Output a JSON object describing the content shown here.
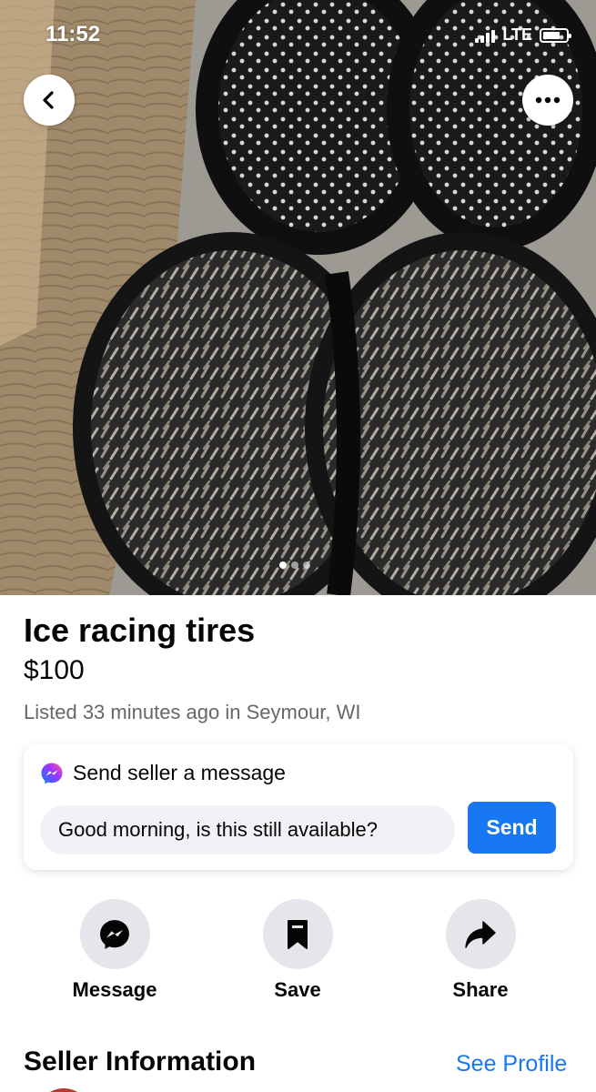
{
  "status_bar": {
    "time": "11:52",
    "network": "LTE"
  },
  "photo": {
    "description_icon": "listing-photo",
    "carousel": {
      "count": 3,
      "active_index": 0
    }
  },
  "nav": {
    "back_icon": "chevron-left-icon",
    "more_icon": "more-horizontal-icon"
  },
  "listing": {
    "title": "Ice racing tires",
    "price": "$100",
    "listed": "Listed 33 minutes ago in Seymour, WI"
  },
  "message_card": {
    "heading": "Send seller a message",
    "input_value": "Good morning, is this still available?",
    "send_label": "Send",
    "icon": "messenger-icon"
  },
  "actions": [
    {
      "label": "Message",
      "icon": "messenger-icon"
    },
    {
      "label": "Save",
      "icon": "bookmark-icon"
    },
    {
      "label": "Share",
      "icon": "share-arrow-icon"
    }
  ],
  "seller": {
    "heading": "Seller Information",
    "see_profile": "See Profile"
  },
  "colors": {
    "accent": "#1877f2",
    "secondary_text": "#65676b",
    "action_circle": "#e4e6eb",
    "input_bg": "#f0f2f5"
  }
}
